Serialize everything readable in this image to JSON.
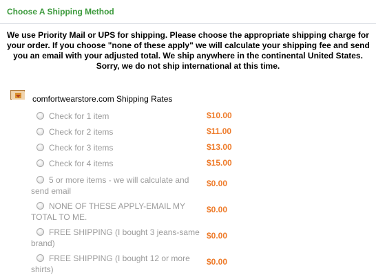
{
  "section": {
    "title": "Choose A Shipping Method"
  },
  "intro": {
    "lines": [
      "We use Priority Mail or UPS for shipping. Please choose the appropriate shipping charge for",
      "your order. If you choose \"none of these apply\" we will calculate your shipping fee and send",
      "you an email with your adjusted total. We ship anywhere in the continental United States.",
      "Sorry, we do not ship international at this time."
    ]
  },
  "carrier": {
    "icon": "shipping-box-icon",
    "name": "comfortwearstore.com Shipping Rates"
  },
  "rates": [
    {
      "label": "Check for 1 item",
      "price": "$10.00"
    },
    {
      "label": "Check for 2 items",
      "price": "$11.00"
    },
    {
      "label": "Check for 3 items",
      "price": "$13.00"
    },
    {
      "label": "Check for 4 items",
      "price": "$15.00"
    },
    {
      "label": "5 or more items - we will calculate and send email",
      "price": "$0.00"
    },
    {
      "label": "NONE OF THESE APPLY-EMAIL MY TOTAL TO ME.",
      "price": "$0.00"
    },
    {
      "label": "FREE SHIPPING (I bought 3 jeans-same brand)",
      "price": "$0.00"
    },
    {
      "label": "FREE SHIPPING (I bought 12 or more shirts)",
      "price": "$0.00"
    }
  ],
  "colors": {
    "title_green": "#3c9a3c",
    "price_orange": "#ee7b2a",
    "label_gray": "#9b9b9b"
  }
}
